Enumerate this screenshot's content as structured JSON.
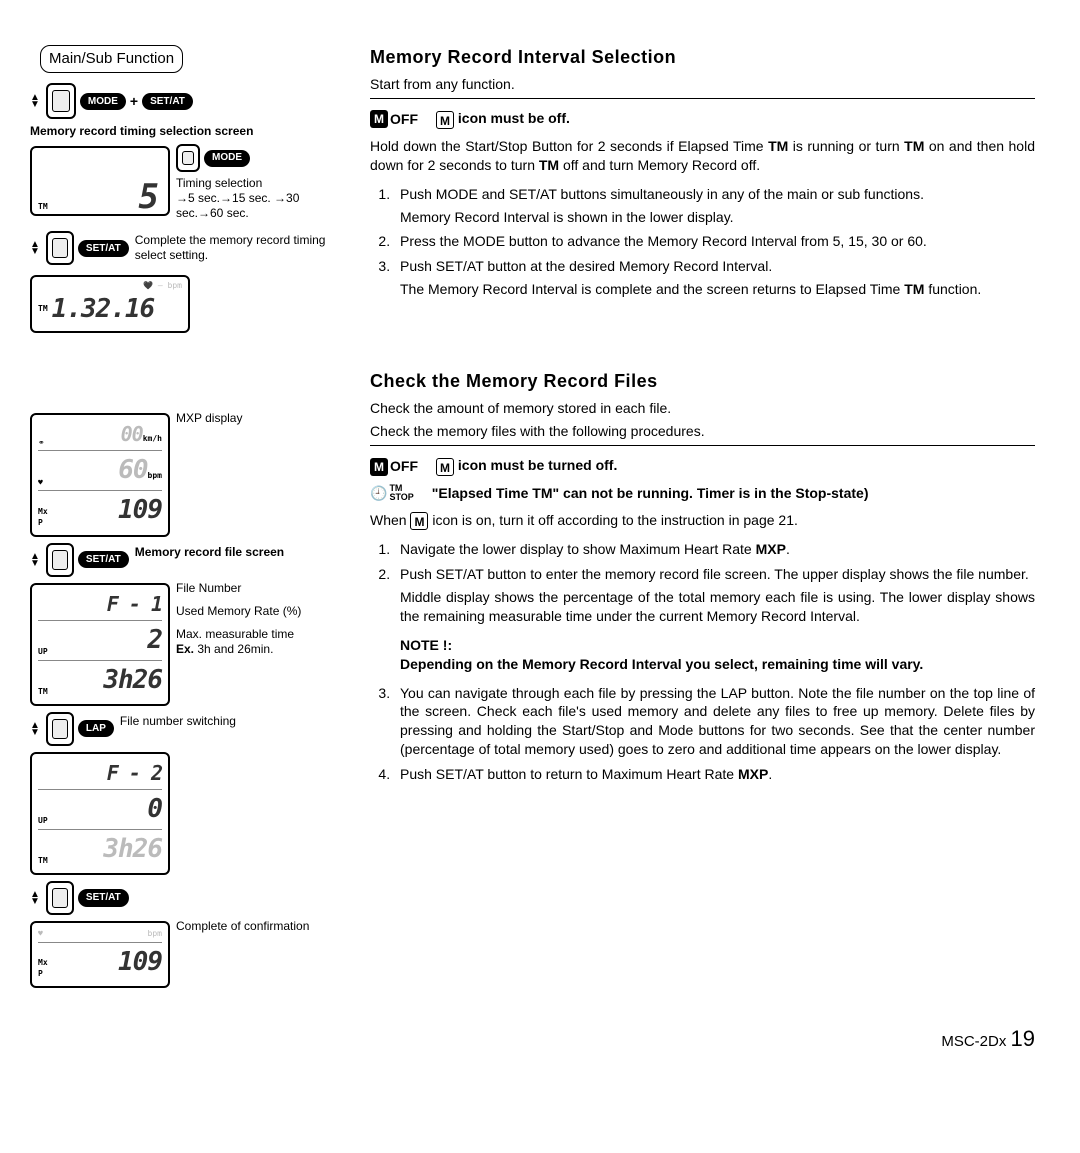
{
  "left": {
    "mainSub": "Main/Sub Function",
    "modePlus": "MODE",
    "setAt": "SET/AT",
    "plus": "+",
    "memTimingTitle": "Memory record timing selection screen",
    "mode": "MODE",
    "timingSel": "Timing selection",
    "timingSeq": "→5 sec.→15 sec. →30 sec.→60 sec.",
    "completeTiming": "Complete the memory record timing select setting.",
    "lcd1_big": "5",
    "lcd1_tm": "TM",
    "lcd1_bottom": "1.32.16",
    "lcd1_bpm": "bpm",
    "lcd2_kmh": "00",
    "lcd2_kmh_unit": "km/h",
    "lcd2_bpm": "60",
    "lcd2_bpm_unit": "bpm",
    "lcd2_mxp": "109",
    "lcd2_mx": "Mx",
    "lcd2_p": "P",
    "mxpDisplay": "MXP display",
    "memFileTitle": "Memory record file screen",
    "fileNum": "File Number",
    "usedMem": "Used Memory Rate (%)",
    "maxMeas": "Max. measurable time",
    "exTime": "Ex.",
    "exTimeVal": "3h and 26min.",
    "lcd3_f": "F - 1",
    "lcd3_pct": "2",
    "lcd3_time": "3h26",
    "lap": "LAP",
    "fileSwitch": "File number switching",
    "lcd4_f": "F - 2",
    "lcd4_pct": "0",
    "lcd4_time": "3h26",
    "completeConf": "Complete of confirmation",
    "lcd5_bpm_unit": "bpm",
    "lcd5_mxp": "109",
    "upIcon": "UP"
  },
  "right": {
    "h1": "Memory Record Interval Selection",
    "intro1": "Start from any function.",
    "off": "OFF",
    "iconOff": "icon must be off.",
    "hold": "Hold down the Start/Stop Button for 2 seconds if Elapsed Time ",
    "tm": "TM",
    "hold2": " is running or turn ",
    "hold3": " on and then hold down for 2 seconds to turn ",
    "hold4": " off and turn Memory Record off.",
    "li1a": "Push MODE and SET/AT buttons simultaneously in any of the main or sub functions.",
    "li1b": "Memory Record Interval is shown in the lower display.",
    "li2": "Press the MODE button to advance the Memory Record Interval from 5, 15, 30 or 60.",
    "li3a": "Push SET/AT button at the desired Memory Record Interval.",
    "li3b": "The Memory Record Interval is complete and the screen returns to Elapsed Time ",
    "li3c": " function.",
    "h2": "Check the Memory Record Files",
    "check1": "Check the amount of memory stored in each file.",
    "check2": "Check the memory files with the following procedures.",
    "iconOff2": "icon must be turned off.",
    "tmSmall": "TM",
    "stop": "STOP",
    "elapsed": "\"Elapsed Time TM\" can not be running. Timer is in the Stop-state)",
    "when1": "When ",
    "when2": " icon is on, turn it off according to the instruction in page 21.",
    "cli1": "Navigate the lower display to show Maximum Heart Rate ",
    "mxp": "MXP",
    "dot": ".",
    "cli2a": "Push SET/AT button to enter the memory record file screen. The upper display shows the file number.",
    "cli2b": "Middle display shows the percentage of the total memory each file is using.  The lower display shows the remaining measurable time under the current Memory Record Interval.",
    "note": "NOTE !:",
    "noteBody": "Depending on the Memory Record Interval you select, remaining time will vary.",
    "cli3": "You can navigate through each file by pressing the LAP button.  Note the file number on the top line of the screen.  Check each file's used memory and delete any files to free up memory.  Delete files by pressing and holding the Start/Stop and Mode buttons for two seconds.  See that the center number (percentage of total memory used) goes to zero and additional time appears on the lower display.",
    "cli4": "Push SET/AT button to return to Maximum Heart Rate "
  },
  "footer": {
    "model": "MSC-2Dx",
    "page": "19"
  }
}
